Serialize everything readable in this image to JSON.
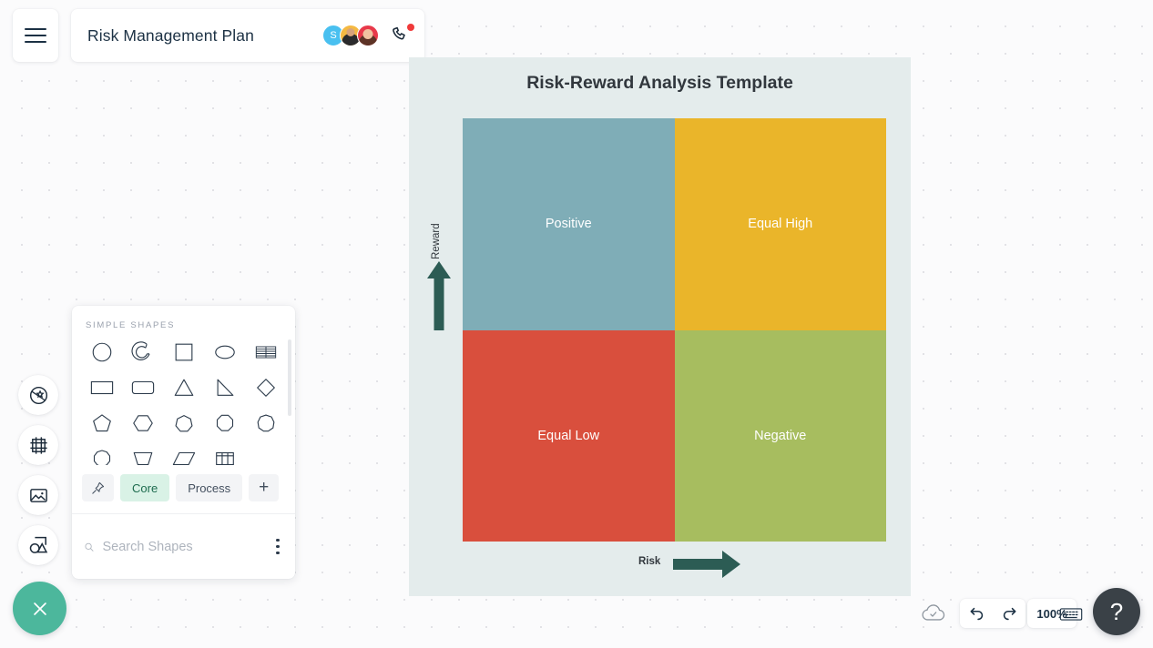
{
  "app": {
    "menu_icon": "hamburger-menu-icon",
    "document_title": "Risk Management Plan"
  },
  "collaborators": {
    "avatars": [
      {
        "initial": "S",
        "color": "#49c0f0"
      },
      {
        "initial": "",
        "color": "#f5b942"
      },
      {
        "initial": "",
        "color": "#e8394a"
      }
    ],
    "call_icon": "phone-call-icon",
    "notification_badge_color": "#f03a3a"
  },
  "left_rail": {
    "items": [
      {
        "icon": "theme-palette-icon",
        "label": "Theme"
      },
      {
        "icon": "frame-icon",
        "label": "Frame"
      },
      {
        "icon": "image-icon",
        "label": "Image"
      },
      {
        "icon": "shapes-icon",
        "label": "Shapes"
      }
    ],
    "close_button": {
      "icon": "close-x-icon",
      "color": "#4cb79c"
    }
  },
  "shapes_panel": {
    "section_title": "SIMPLE SHAPES",
    "shapes": [
      "circle",
      "arc",
      "square",
      "ellipse",
      "table-rows",
      "rectangle",
      "rounded-rectangle",
      "triangle",
      "right-triangle",
      "diamond",
      "pentagon",
      "hexagon",
      "heptagon",
      "octagon",
      "nonagon",
      "decagon",
      "trapezoid",
      "parallelogram",
      "grid-table"
    ],
    "tabs": [
      {
        "label": "",
        "icon": "pin-icon",
        "active": false
      },
      {
        "label": "Core",
        "active": true
      },
      {
        "label": "Process",
        "active": false
      },
      {
        "label": "+",
        "active": false
      }
    ],
    "search": {
      "placeholder": "Search Shapes",
      "value": "",
      "icon": "search-icon"
    },
    "more_icon": "kebab-menu-icon"
  },
  "canvas": {
    "title": "Risk-Reward Analysis Template",
    "y_axis_label": "Reward",
    "x_axis_label": "Risk",
    "arrow_color": "#2c5c54",
    "page_background": "#e4ecec"
  },
  "chart_data": {
    "type": "matrix",
    "title": "Risk-Reward Analysis Template",
    "xlabel": "Risk",
    "ylabel": "Reward",
    "rows": 2,
    "cols": 2,
    "quadrants": [
      {
        "position": "top-left",
        "label": "Positive",
        "color": "#7fadb7",
        "risk": "low",
        "reward": "high"
      },
      {
        "position": "top-right",
        "label": "Equal High",
        "color": "#eab52a",
        "risk": "high",
        "reward": "high"
      },
      {
        "position": "bottom-left",
        "label": "Equal Low",
        "color": "#d94f3d",
        "risk": "low",
        "reward": "low"
      },
      {
        "position": "bottom-right",
        "label": "Negative",
        "color": "#a7bd5f",
        "risk": "high",
        "reward": "low"
      }
    ],
    "legend": "none",
    "grid": false
  },
  "status_bar": {
    "save_icon": "cloud-saved-icon",
    "undo_icon": "undo-arrow-icon",
    "redo_icon": "redo-arrow-icon",
    "zoom_level": "100%",
    "keyboard_icon": "keyboard-shortcuts-icon",
    "help_label": "?"
  }
}
